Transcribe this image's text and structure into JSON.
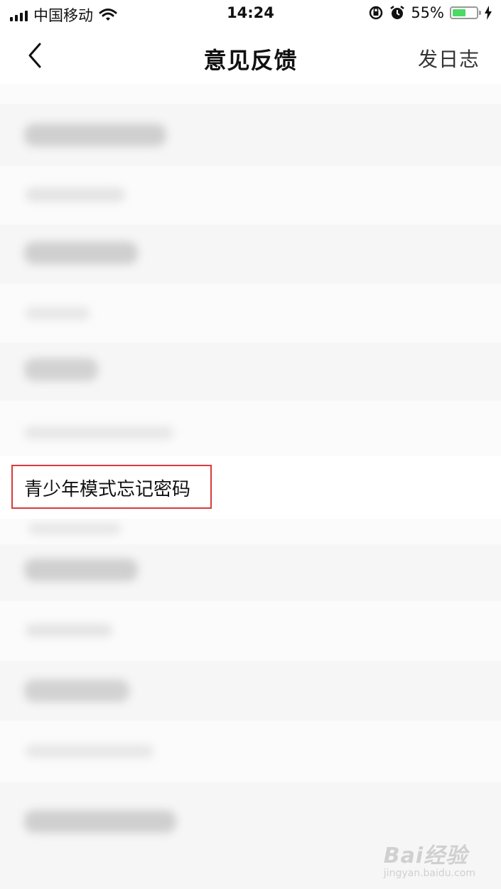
{
  "status_bar": {
    "carrier": "中国移动",
    "time": "14:24",
    "battery_percent": "55%",
    "battery_level": 0.55,
    "colors": {
      "battery_fill": "#4cd964"
    }
  },
  "nav": {
    "title": "意见反馈",
    "right_button": "发日志",
    "back_icon": "chevron-left-icon"
  },
  "list": {
    "highlighted_item": "青少年模式忘记密码",
    "highlight_color": "#d83b3b"
  },
  "watermark": {
    "brand": "Bai经验",
    "url": "jingyan.baidu.com"
  }
}
